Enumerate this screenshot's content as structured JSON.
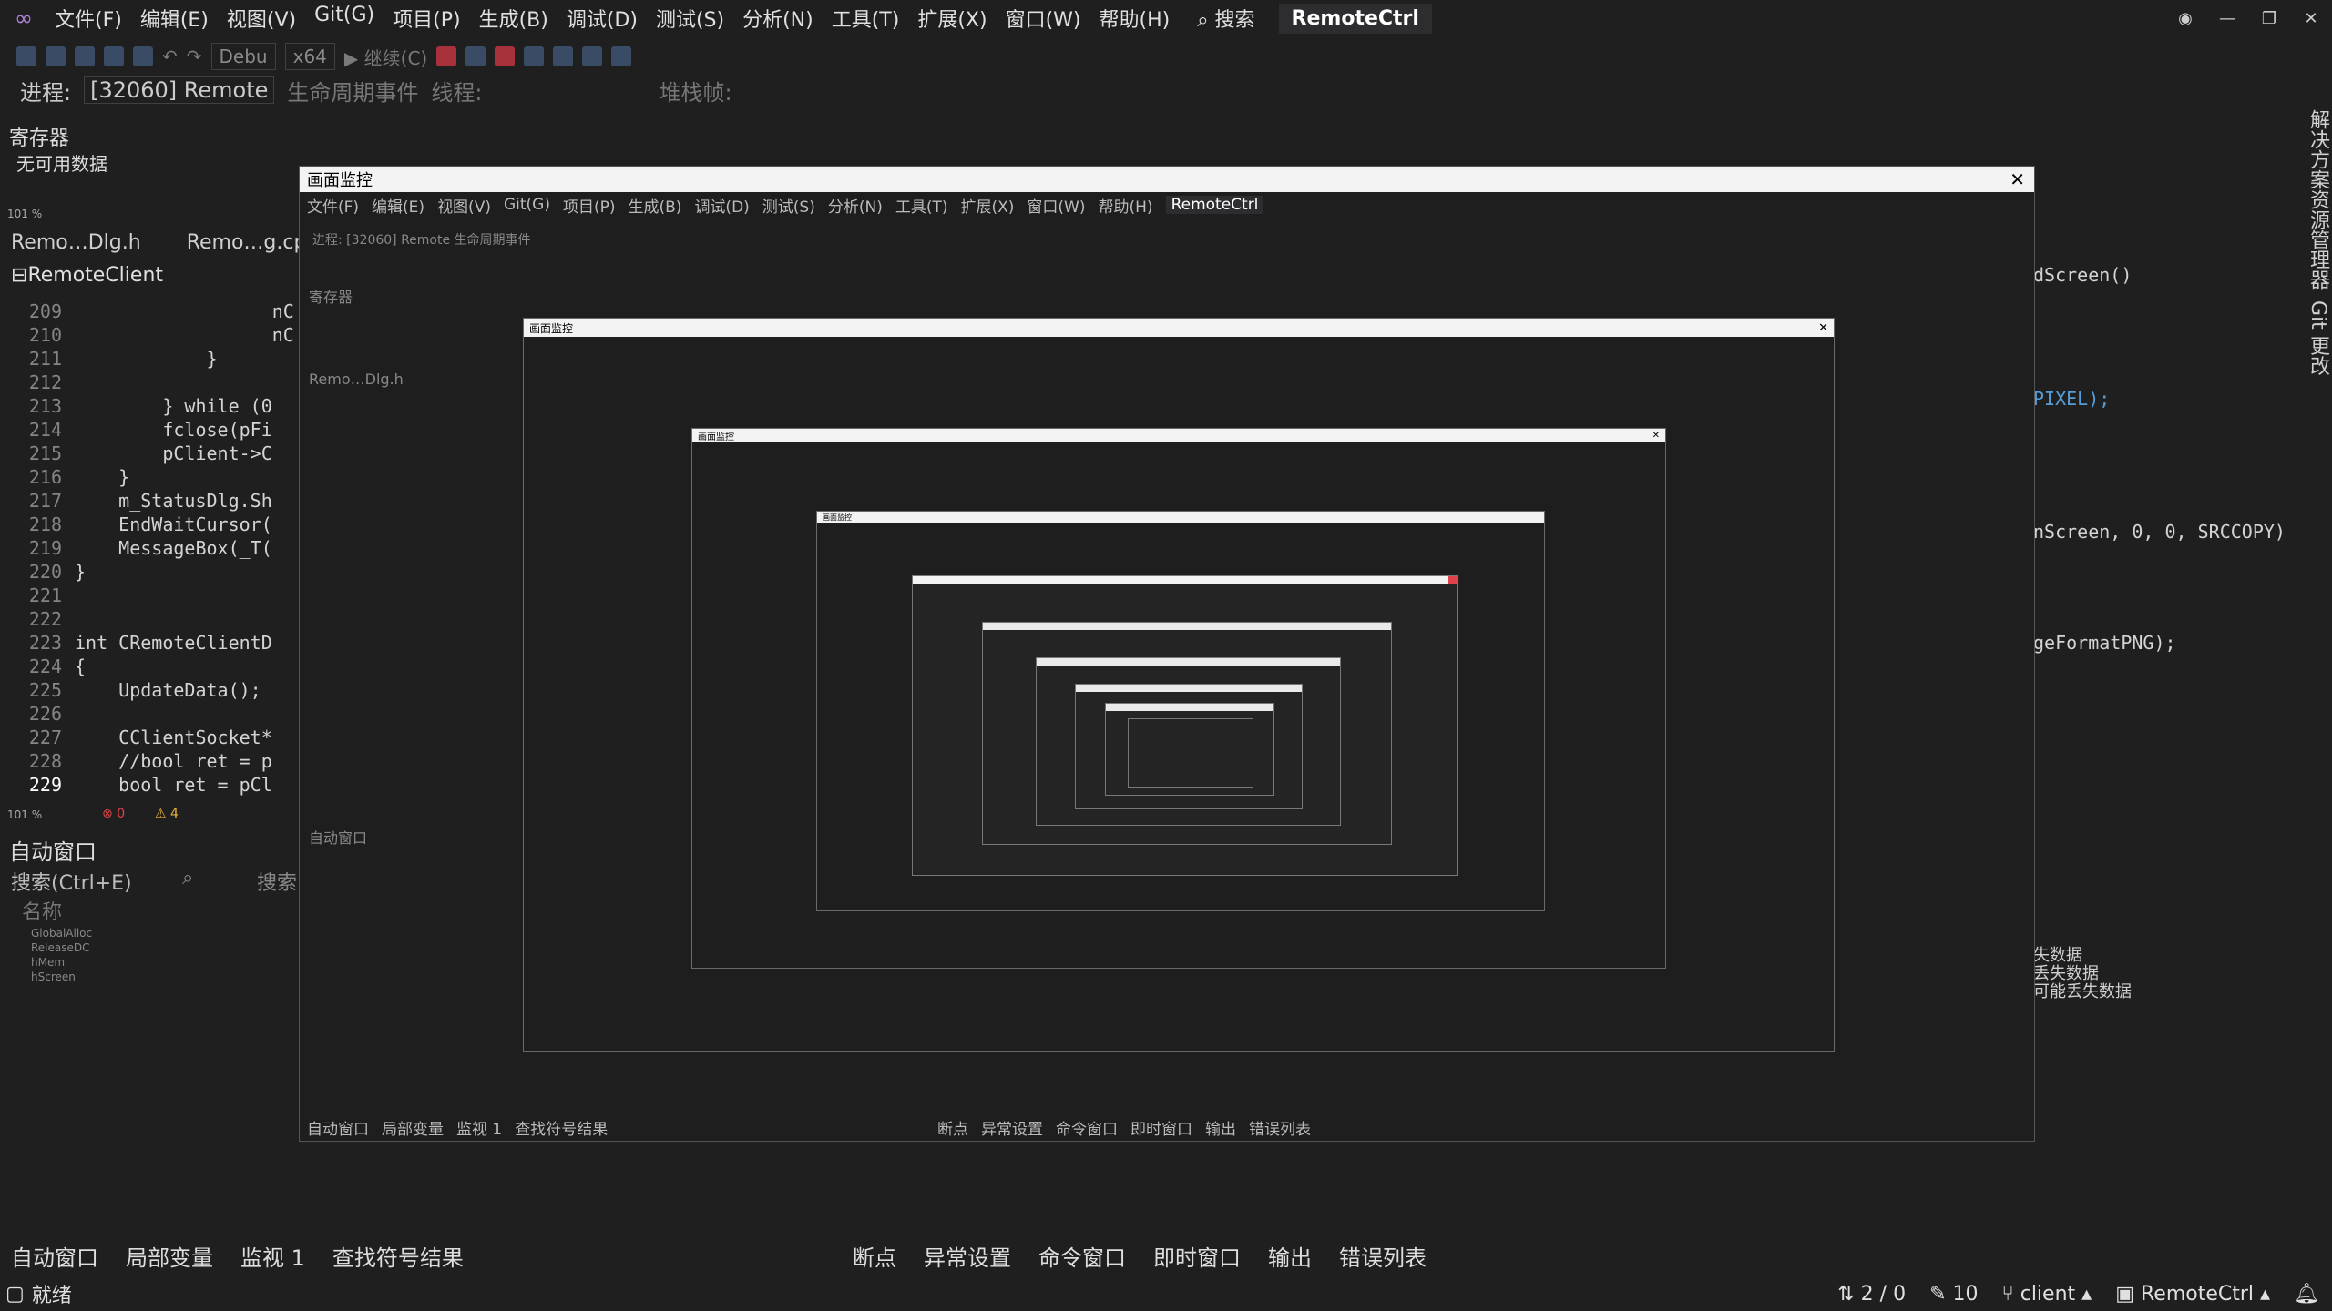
{
  "menu": [
    "文件(F)",
    "编辑(E)",
    "视图(V)",
    "Git(G)",
    "项目(P)",
    "生成(B)",
    "调试(D)",
    "测试(S)",
    "分析(N)",
    "工具(T)",
    "扩展(X)",
    "窗口(W)",
    "帮助(H)"
  ],
  "search_label": "搜索",
  "solution_name": "RemoteCtrl",
  "toolbar": {
    "config": "Debu",
    "platform": "x64",
    "continue": "继续(C)"
  },
  "process": {
    "label": "进程:",
    "value": "[32060] Remote",
    "lifecycle": "生命周期事件",
    "thread": "线程:",
    "stack": "堆栈帧:"
  },
  "registers": {
    "title": "寄存器",
    "empty": "无可用数据"
  },
  "editor": {
    "zoom": "101 %",
    "tab1": "Remo…Dlg.h",
    "tab2": "Remo…g.cp",
    "scope": "RemoteClient",
    "lines": [
      {
        "n": "209",
        "code": "                  nC"
      },
      {
        "n": "210",
        "code": "                  nC"
      },
      {
        "n": "211",
        "code": "            }"
      },
      {
        "n": "212",
        "code": ""
      },
      {
        "n": "213",
        "code": "        } while (0"
      },
      {
        "n": "214",
        "code": "        fclose(pFi"
      },
      {
        "n": "215",
        "code": "        pClient->C"
      },
      {
        "n": "216",
        "code": "    }"
      },
      {
        "n": "217",
        "code": "    m_StatusDlg.Sh"
      },
      {
        "n": "218",
        "code": "    EndWaitCursor("
      },
      {
        "n": "219",
        "code": "    MessageBox(_T("
      },
      {
        "n": "220",
        "code": "}"
      },
      {
        "n": "221",
        "code": ""
      },
      {
        "n": "222",
        "code": ""
      },
      {
        "n": "223",
        "code": "int CRemoteClientD"
      },
      {
        "n": "224",
        "code": "{"
      },
      {
        "n": "225",
        "code": "    UpdateData();"
      },
      {
        "n": "226",
        "code": ""
      },
      {
        "n": "227",
        "code": "    CClientSocket*"
      },
      {
        "n": "228",
        "code": "    //bool ret = p"
      },
      {
        "n": "229",
        "code": "    bool ret = pCl"
      }
    ],
    "status_errors": "0",
    "status_warnings": "4"
  },
  "right_code": [
    "dScreen()",
    "PIXEL);",
    "nScreen, 0, 0, SRCCOPY)",
    "geFormatPNG);"
  ],
  "right_output": [
    "失数据",
    "丢失数据",
    "可能丢失数据"
  ],
  "right_vtabs": [
    "解决方案资源管理器",
    "Git 更改"
  ],
  "autos": {
    "title": "自动窗口",
    "search_placeholder": "搜索(Ctrl+E)",
    "search_label": "搜索",
    "name_header": "名称",
    "rows": [
      "GlobalAlloc",
      "ReleaseDC",
      "hMem",
      "hScreen"
    ]
  },
  "bottom_tabs_left": [
    "自动窗口",
    "局部变量",
    "监视 1",
    "查找符号结果"
  ],
  "bottom_tabs_right": [
    "断点",
    "异常设置",
    "命令窗口",
    "即时窗口",
    "输出",
    "错误列表"
  ],
  "statusbar": {
    "ready": "就绪",
    "lines": "2 / 0",
    "edits": "10",
    "branch": "client",
    "repo": "RemoteCtrl"
  },
  "monitor": {
    "title": "画面监控",
    "nested_title": "画面监控"
  },
  "colors": {
    "bg": "#1f1f1f",
    "accent": "#569cd6",
    "brand": "#b180d7"
  }
}
